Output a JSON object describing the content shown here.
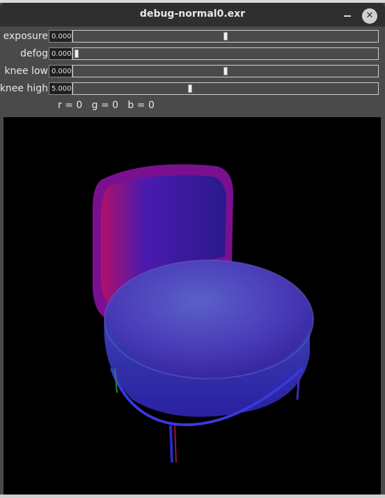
{
  "window": {
    "title": "debug-normal0.exr"
  },
  "controls": [
    {
      "label": "exposure",
      "value": "0.000",
      "slider_fraction": 0.5
    },
    {
      "label": "defog",
      "value": "0.0000",
      "slider_fraction": 0.0
    },
    {
      "label": "knee low",
      "value": "0.000",
      "slider_fraction": 0.5
    },
    {
      "label": "knee high",
      "value": "5.000",
      "slider_fraction": 0.38
    }
  ],
  "pixel_readout": "r = 0   g = 0   b = 0",
  "icons": {
    "minimize": "minimize-icon",
    "close": "close-icon"
  },
  "colors": {
    "titlebar": "#2f2f2f",
    "panel": "#4a4a4a",
    "viewport": "#000000"
  }
}
